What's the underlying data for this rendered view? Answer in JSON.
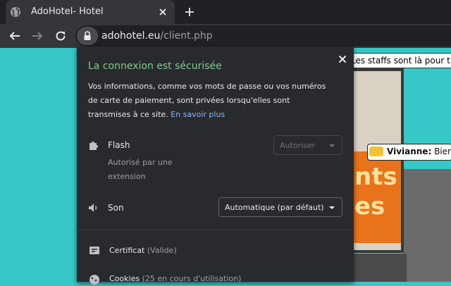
{
  "tab": {
    "title": "AdoHotel- Hotel",
    "globe_icon": "globe-icon",
    "close_icon": "close-icon"
  },
  "newtab": {
    "icon": "plus-icon"
  },
  "toolbar": {
    "back_icon": "arrow-left-icon",
    "forward_icon": "arrow-right-icon",
    "reload_icon": "reload-icon"
  },
  "omnibox": {
    "domain": "adohotel.eu",
    "path": "/client.php",
    "lock_icon": "lock-icon"
  },
  "page": {
    "banner": "Les staffs sont là pour t'ai",
    "game_text": "nts\nes",
    "chat": {
      "name": "Vivianne:",
      "message": "Bienve"
    }
  },
  "popup": {
    "title": "La connexion est sécurisée",
    "description": "Vos informations, comme vos mots de passe ou vos numéros de carte de paiement, sont privées lorsqu'elles sont transmises à ce site.",
    "learn_more": "En savoir plus",
    "flash": {
      "label": "Flash",
      "sublabel": "Autorisé par une extension",
      "select_value": "Autoriser",
      "icon": "puzzle-icon"
    },
    "sound": {
      "label": "Son",
      "select_value": "Automatique (par défaut)",
      "icon": "speaker-icon"
    },
    "certificate": {
      "label": "Certificat",
      "status": "(Valide)",
      "icon": "certificate-icon"
    },
    "cookies": {
      "label": "Cookies",
      "status": "(25 en cours d'utilisation)",
      "icon": "cookie-icon"
    }
  },
  "colors": {
    "secure_green": "#81c995",
    "link_blue": "#8ab4f8",
    "page_teal": "#36c7c6",
    "chrome_dark": "#202124",
    "popup_bg": "#292a2d"
  }
}
